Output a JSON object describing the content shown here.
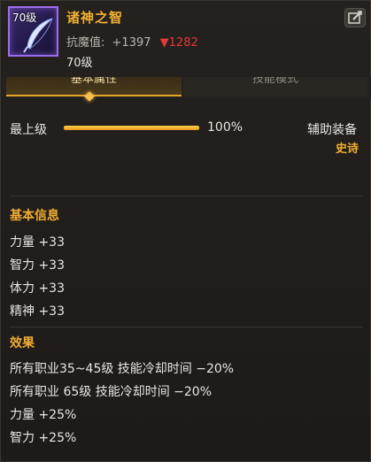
{
  "item": {
    "icon_level": "70级",
    "name": "诸神之智",
    "resist_label": "抗魔值:",
    "resist_plus": "+1397",
    "resist_down_arrow": "▼",
    "resist_down": "1282",
    "level_req": "70级"
  },
  "tabs": {
    "active": "基本属性",
    "inactive": "技能模式"
  },
  "level_row": {
    "label": "最上级",
    "progress_percent": 100,
    "percent_text": "100%",
    "equip_type": "辅助装备",
    "rarity": "史诗"
  },
  "basic_info": {
    "title": "基本信息",
    "stats": [
      "力量 +33",
      "智力 +33",
      "体力 +33",
      "精神 +33"
    ]
  },
  "effects": {
    "title": "效果",
    "lines": [
      "所有职业35~45级 技能冷却时间 −20%",
      "所有职业 65级 技能冷却时间 −20%",
      "力量 +25%",
      "智力 +25%"
    ]
  },
  "colors": {
    "accent": "#f0ad33",
    "rarity_border": "#9c6df0",
    "decrease": "#e53935"
  }
}
